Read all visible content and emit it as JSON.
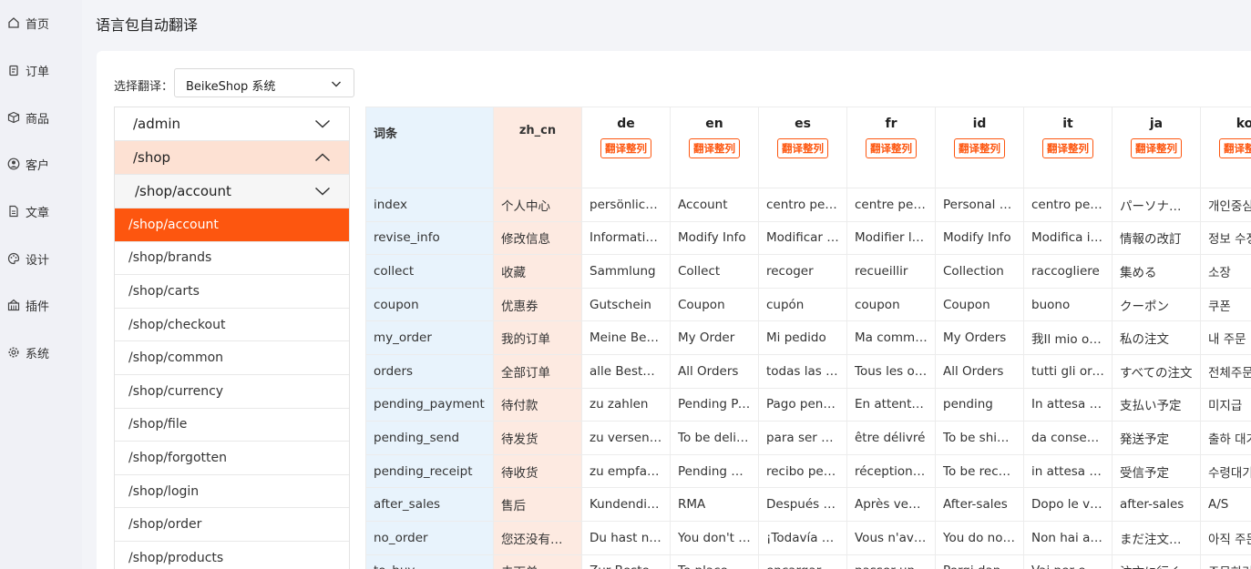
{
  "sidebar": {
    "items": [
      {
        "icon": "home-icon",
        "label": "首页"
      },
      {
        "icon": "clipboard-icon",
        "label": "订单"
      },
      {
        "icon": "box-icon",
        "label": "商品"
      },
      {
        "icon": "user-icon",
        "label": "客户"
      },
      {
        "icon": "document-icon",
        "label": "文章"
      },
      {
        "icon": "palette-icon",
        "label": "设计"
      },
      {
        "icon": "plugin-icon",
        "label": "插件"
      },
      {
        "icon": "gear-icon",
        "label": "系统"
      }
    ]
  },
  "page": {
    "title": "语言包自动翻译"
  },
  "selector": {
    "label": "选择翻译：",
    "value": "BeikeShop 系统"
  },
  "tree": {
    "groups": [
      {
        "label": "/admin",
        "expanded": false
      },
      {
        "label": "/shop",
        "expanded": true
      },
      {
        "label": "/shop/account",
        "expanded": false
      }
    ],
    "leaves": [
      {
        "label": "/shop/account",
        "active": true
      },
      {
        "label": "/shop/brands"
      },
      {
        "label": "/shop/carts"
      },
      {
        "label": "/shop/checkout"
      },
      {
        "label": "/shop/common"
      },
      {
        "label": "/shop/currency"
      },
      {
        "label": "/shop/file"
      },
      {
        "label": "/shop/forgotten"
      },
      {
        "label": "/shop/login"
      },
      {
        "label": "/shop/order"
      },
      {
        "label": "/shop/products"
      }
    ]
  },
  "table": {
    "key_header": "词条",
    "source_header": "zh_cn",
    "translate_button": "翻译整列",
    "languages": [
      "de",
      "en",
      "es",
      "fr",
      "id",
      "it",
      "ja",
      "ko"
    ],
    "rows": [
      [
        "index",
        "个人中心",
        "persönliches Zentrum",
        "Account",
        "centro personal",
        "centre personnel",
        "Personal Center",
        "centro personale",
        "パーソナルセンター",
        "개인중심"
      ],
      [
        "revise_info",
        "修改信息",
        "Informationen ändern",
        "Modify Info",
        "Modificar información",
        "Modifier les informations",
        "Modify Info",
        "Modifica informazioni",
        "情報の改訂",
        "정보 수정"
      ],
      [
        "collect",
        "收藏",
        "Sammlung",
        "Collect",
        "recoger",
        "recueillir",
        "Collection",
        "raccogliere",
        "集める",
        "소장"
      ],
      [
        "coupon",
        "优惠券",
        "Gutschein",
        "Coupon",
        "cupón",
        "coupon",
        "Coupon",
        "buono",
        "クーポン",
        "쿠폰"
      ],
      [
        "my_order",
        "我的订单",
        "Meine Bestellung",
        "My Order",
        "Mi pedido",
        "Ma commande",
        "My Orders",
        "我Il mio ordine",
        "私の注文",
        "내 주문"
      ],
      [
        "orders",
        "全部订单",
        "alle Bestellungen",
        "All Orders",
        "todas las órdenes",
        "Tous les ordres",
        "All Orders",
        "tutti gli ordini",
        "すべての注文",
        "전체주문"
      ],
      [
        "pending_payment",
        "待付款",
        "zu zahlen",
        "Pending Payment",
        "Pago pendiente",
        "En attente de paiement",
        "pending",
        "In attesa di pagamento",
        "支払い予定",
        "미지급"
      ],
      [
        "pending_send",
        "待发货",
        "zu versenden",
        "To be delivered",
        "para ser enviado",
        "être délivré",
        "To be shipped",
        "da consegnare",
        "発送予定",
        "출하 대기"
      ],
      [
        "pending_receipt",
        "待收货",
        "zu empfangen",
        "Pending Receipt",
        "recibo pendiente",
        "réception en attente",
        "To be received",
        "in attesa di ricezione",
        "受信予定",
        "수령대기"
      ],
      [
        "after_sales",
        "售后",
        "Kundendienst",
        "RMA",
        "Después de la venta",
        "Après vente",
        "After-sales",
        "Dopo le vendite",
        "after-sales",
        "A/S"
      ],
      [
        "no_order",
        "您还没有订单！",
        "Du hast noch keine Bestellung",
        "You don't have any orders yet",
        "¡Todavía no tienes pedidos!",
        "Vous n'avez pas encore de commande",
        "You do not have an order yet",
        "Non hai ancora ordini",
        "まだ注文がありません",
        "아직 주문이 없습니다"
      ],
      [
        "to_buy",
        "去下单",
        "Zur Bestellung",
        "To place an order",
        "encargar",
        "passer une commande",
        "Pergi dan pesan",
        "Vai per effettuare un ordine",
        "注文に行く",
        "주문하러 가기"
      ]
    ]
  }
}
